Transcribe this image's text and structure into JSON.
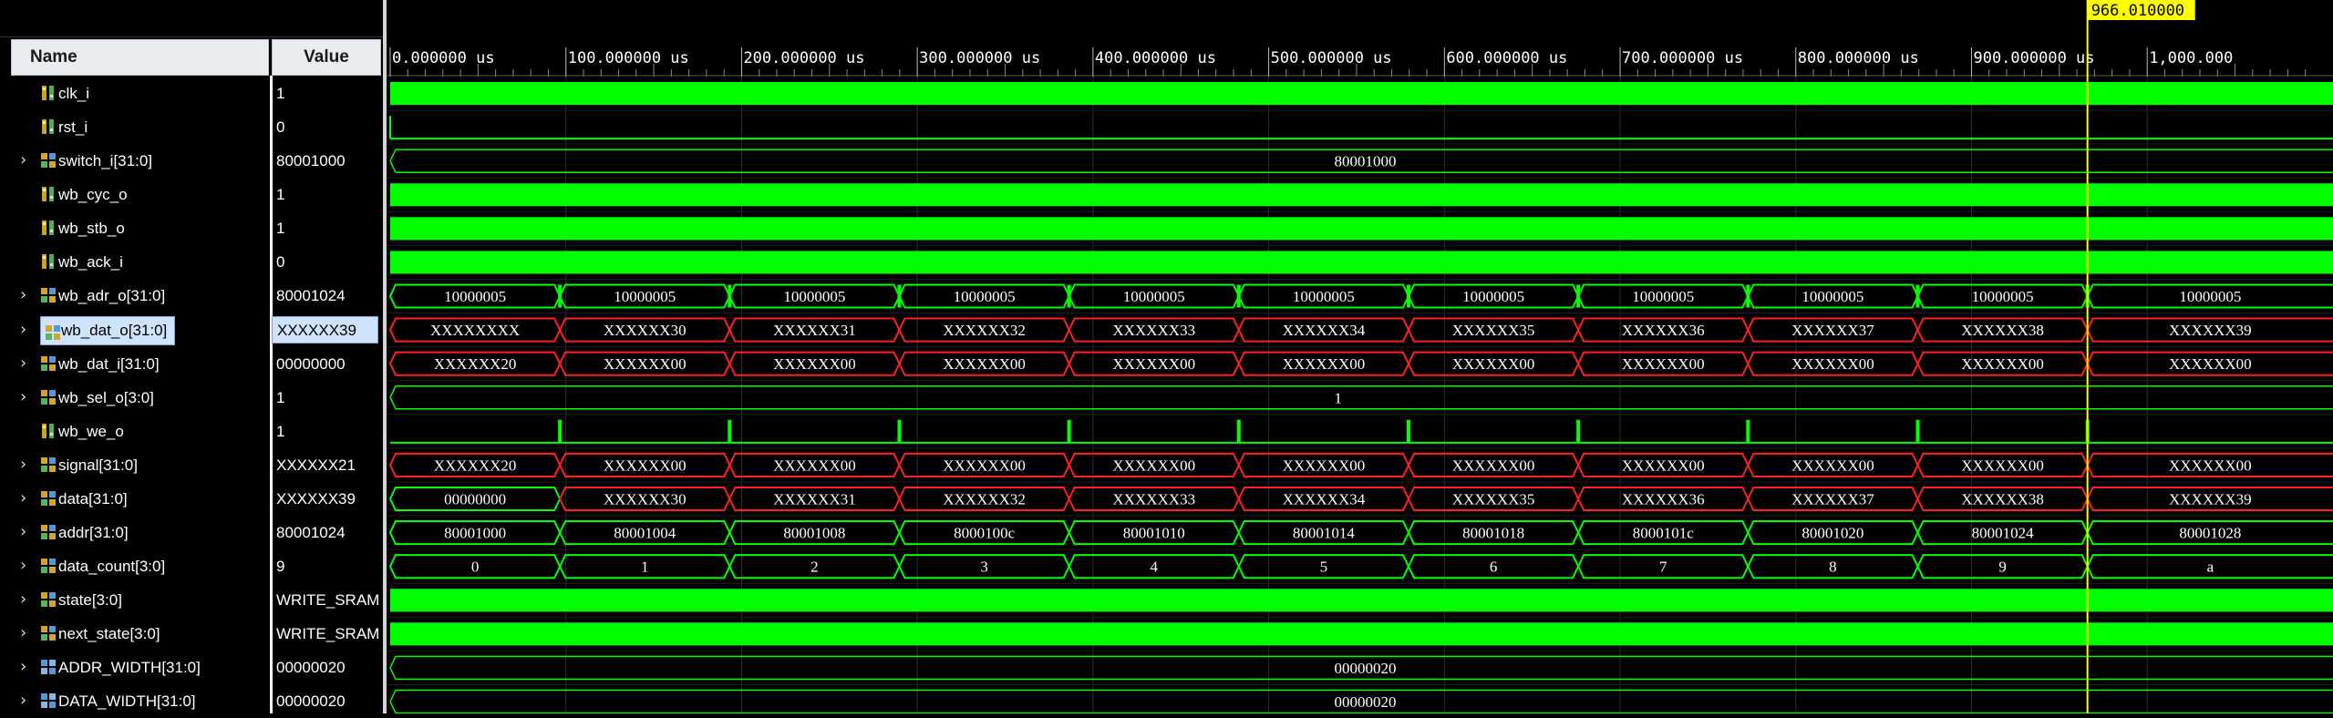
{
  "headers": {
    "name": "Name",
    "value": "Value"
  },
  "timeline": {
    "ticks": [
      "0.000000 us",
      "100.000000 us",
      "200.000000 us",
      "300.000000 us",
      "400.000000 us",
      "500.000000 us",
      "600.000000 us",
      "700.000000 us",
      "800.000000 us",
      "900.000000 us",
      "1,000.000"
    ],
    "cursor_label": "966.010000 u",
    "cursor_time_us": 966.01
  },
  "colors": {
    "waveform": "#00ff00",
    "error": "#ff2020",
    "cursor": "#ffff00",
    "background": "#000000",
    "selection": "#cfe3fb"
  },
  "signals": [
    {
      "name": "clk_i",
      "value": "1",
      "kind": "bit",
      "icon": "bit-signal-icon",
      "expandable": false,
      "wave": "clock"
    },
    {
      "name": "rst_i",
      "value": "0",
      "kind": "bit",
      "icon": "bit-signal-icon",
      "expandable": false,
      "wave": "reset"
    },
    {
      "name": "switch_i[31:0]",
      "value": "80001000",
      "kind": "bus",
      "icon": "bus-signal-icon",
      "expandable": true,
      "wave": "constant",
      "label": "80001000"
    },
    {
      "name": "wb_cyc_o",
      "value": "1",
      "kind": "bit",
      "icon": "bit-signal-icon",
      "expandable": false,
      "wave": "solid"
    },
    {
      "name": "wb_stb_o",
      "value": "1",
      "kind": "bit",
      "icon": "bit-signal-icon",
      "expandable": false,
      "wave": "solid"
    },
    {
      "name": "wb_ack_i",
      "value": "0",
      "kind": "bit",
      "icon": "bit-signal-icon",
      "expandable": false,
      "wave": "solid"
    },
    {
      "name": "wb_adr_o[31:0]",
      "value": "80001024",
      "kind": "bus",
      "icon": "bus-signal-icon",
      "expandable": true,
      "wave": "segments",
      "edge": "green",
      "segments": [
        "10000005",
        "10000005",
        "10000005",
        "10000005",
        "10000005",
        "10000005",
        "10000005",
        "10000005",
        "10000005",
        "10000005",
        "10000005"
      ]
    },
    {
      "name": "wb_dat_o[31:0]",
      "value": "XXXXXX39",
      "kind": "bus",
      "icon": "bus-signal-icon",
      "expandable": true,
      "wave": "segments",
      "selected": true,
      "color": "red",
      "segments": [
        "XXXXXXXX",
        "XXXXXX30",
        "XXXXXX31",
        "XXXXXX32",
        "XXXXXX33",
        "XXXXXX34",
        "XXXXXX35",
        "XXXXXX36",
        "XXXXXX37",
        "XXXXXX38",
        "XXXXXX39"
      ]
    },
    {
      "name": "wb_dat_i[31:0]",
      "value": "00000000",
      "kind": "bus",
      "icon": "bus-signal-icon",
      "expandable": true,
      "wave": "segments",
      "color": "red",
      "ellipsis": true,
      "segments": [
        "XXXXXX20",
        "XXXXXX00",
        "XXXXXX00",
        "XXXXXX00",
        "XXXXXX00",
        "XXXXXX00",
        "XXXXXX00",
        "XXXXXX00",
        "XXXXXX00",
        "XXXXXX00",
        "XXXXXX00"
      ]
    },
    {
      "name": "wb_sel_o[3:0]",
      "value": "1",
      "kind": "bus",
      "icon": "bus-signal-icon",
      "expandable": true,
      "wave": "constant",
      "label": "1"
    },
    {
      "name": "wb_we_o",
      "value": "1",
      "kind": "bit",
      "icon": "bit-signal-icon",
      "expandable": false,
      "wave": "pulses"
    },
    {
      "name": "signal[31:0]",
      "value": "XXXXXX21",
      "kind": "bus",
      "icon": "bus-signal-icon",
      "expandable": true,
      "wave": "segments",
      "color": "red",
      "ellipsis": true,
      "segments": [
        "XXXXXX20",
        "XXXXXX00",
        "XXXXXX00",
        "XXXXXX00",
        "XXXXXX00",
        "XXXXXX00",
        "XXXXXX00",
        "XXXXXX00",
        "XXXXXX00",
        "XXXXXX00",
        "XXXXXX00"
      ]
    },
    {
      "name": "data[31:0]",
      "value": "XXXXXX39",
      "kind": "bus",
      "icon": "bus-signal-icon",
      "expandable": true,
      "wave": "segments",
      "color": "red",
      "first_green": true,
      "segments": [
        "00000000",
        "XXXXXX30",
        "XXXXXX31",
        "XXXXXX32",
        "XXXXXX33",
        "XXXXXX34",
        "XXXXXX35",
        "XXXXXX36",
        "XXXXXX37",
        "XXXXXX38",
        "XXXXXX39"
      ]
    },
    {
      "name": "addr[31:0]",
      "value": "80001024",
      "kind": "bus",
      "icon": "bus-signal-icon",
      "expandable": true,
      "wave": "segments",
      "segments": [
        "80001000",
        "80001004",
        "80001008",
        "8000100c",
        "80001010",
        "80001014",
        "80001018",
        "8000101c",
        "80001020",
        "80001024",
        "80001028"
      ]
    },
    {
      "name": "data_count[3:0]",
      "value": "9",
      "kind": "bus",
      "icon": "bus-signal-icon",
      "expandable": true,
      "wave": "segments",
      "segments": [
        "0",
        "1",
        "2",
        "3",
        "4",
        "5",
        "6",
        "7",
        "8",
        "9",
        "a"
      ]
    },
    {
      "name": "state[3:0]",
      "value": "WRITE_SRAM",
      "kind": "bus",
      "icon": "bus-signal-icon",
      "expandable": true,
      "wave": "solid"
    },
    {
      "name": "next_state[3:0]",
      "value": "WRITE_SRAM",
      "kind": "bus",
      "icon": "bus-signal-icon",
      "expandable": true,
      "wave": "solid"
    },
    {
      "name": "ADDR_WIDTH[31:0]",
      "value": "00000020",
      "kind": "param",
      "icon": "param-signal-icon",
      "expandable": true,
      "wave": "constant",
      "label": "00000020"
    },
    {
      "name": "DATA_WIDTH[31:0]",
      "value": "00000020",
      "kind": "param",
      "icon": "param-signal-icon",
      "expandable": true,
      "wave": "constant",
      "label": "00000020"
    }
  ]
}
